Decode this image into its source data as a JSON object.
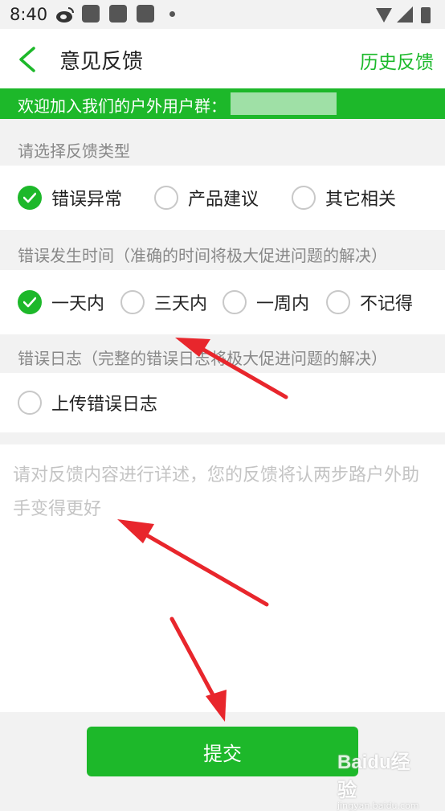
{
  "status_bar": {
    "time": "8:40"
  },
  "header": {
    "back_icon": "chevron-left-icon",
    "title": "意见反馈",
    "history_link": "历史反馈"
  },
  "banner": {
    "text": "欢迎加入我们的户外用户群："
  },
  "feedback_type": {
    "label": "请选择反馈类型",
    "options": [
      {
        "label": "错误异常",
        "selected": true
      },
      {
        "label": "产品建议",
        "selected": false
      },
      {
        "label": "其它相关",
        "selected": false
      }
    ]
  },
  "error_time": {
    "label": "错误发生时间（准确的时间将极大促进问题的解决）",
    "options": [
      {
        "label": "一天内",
        "selected": true
      },
      {
        "label": "三天内",
        "selected": false
      },
      {
        "label": "一周内",
        "selected": false
      },
      {
        "label": "不记得",
        "selected": false
      }
    ]
  },
  "error_log": {
    "label": "错误日志（完整的错误日志将极大促进问题的解决）",
    "upload_label": "上传错误日志",
    "selected": false
  },
  "details": {
    "placeholder": "请对反馈内容进行详述，您的反馈将认两步路户外助手变得更好"
  },
  "submit": {
    "label": "提交"
  },
  "watermark": {
    "main": "Baidu经验",
    "sub": "jingyan.baidu.com"
  },
  "colors": {
    "accent": "#1db82a",
    "annotation": "#e8262c"
  }
}
